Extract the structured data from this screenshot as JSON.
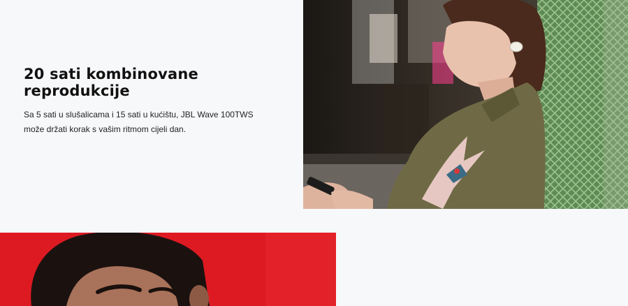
{
  "feature": {
    "title": "20 sati kombinovane reprodukcije",
    "body": "Sa 5 sati u slušalicama i 15 sati u kućištu, JBL Wave 100TWS može držati korak s vašim ritmom cijeli dan."
  },
  "images": {
    "top_right": "woman-earbuds-photo",
    "bottom_left": "man-red-background-photo"
  },
  "colors": {
    "page_bg": "#f7f8fa",
    "red_bg": "#dd1a22",
    "jacket": "#6f6a45",
    "wall_green": "#6f9a63"
  }
}
